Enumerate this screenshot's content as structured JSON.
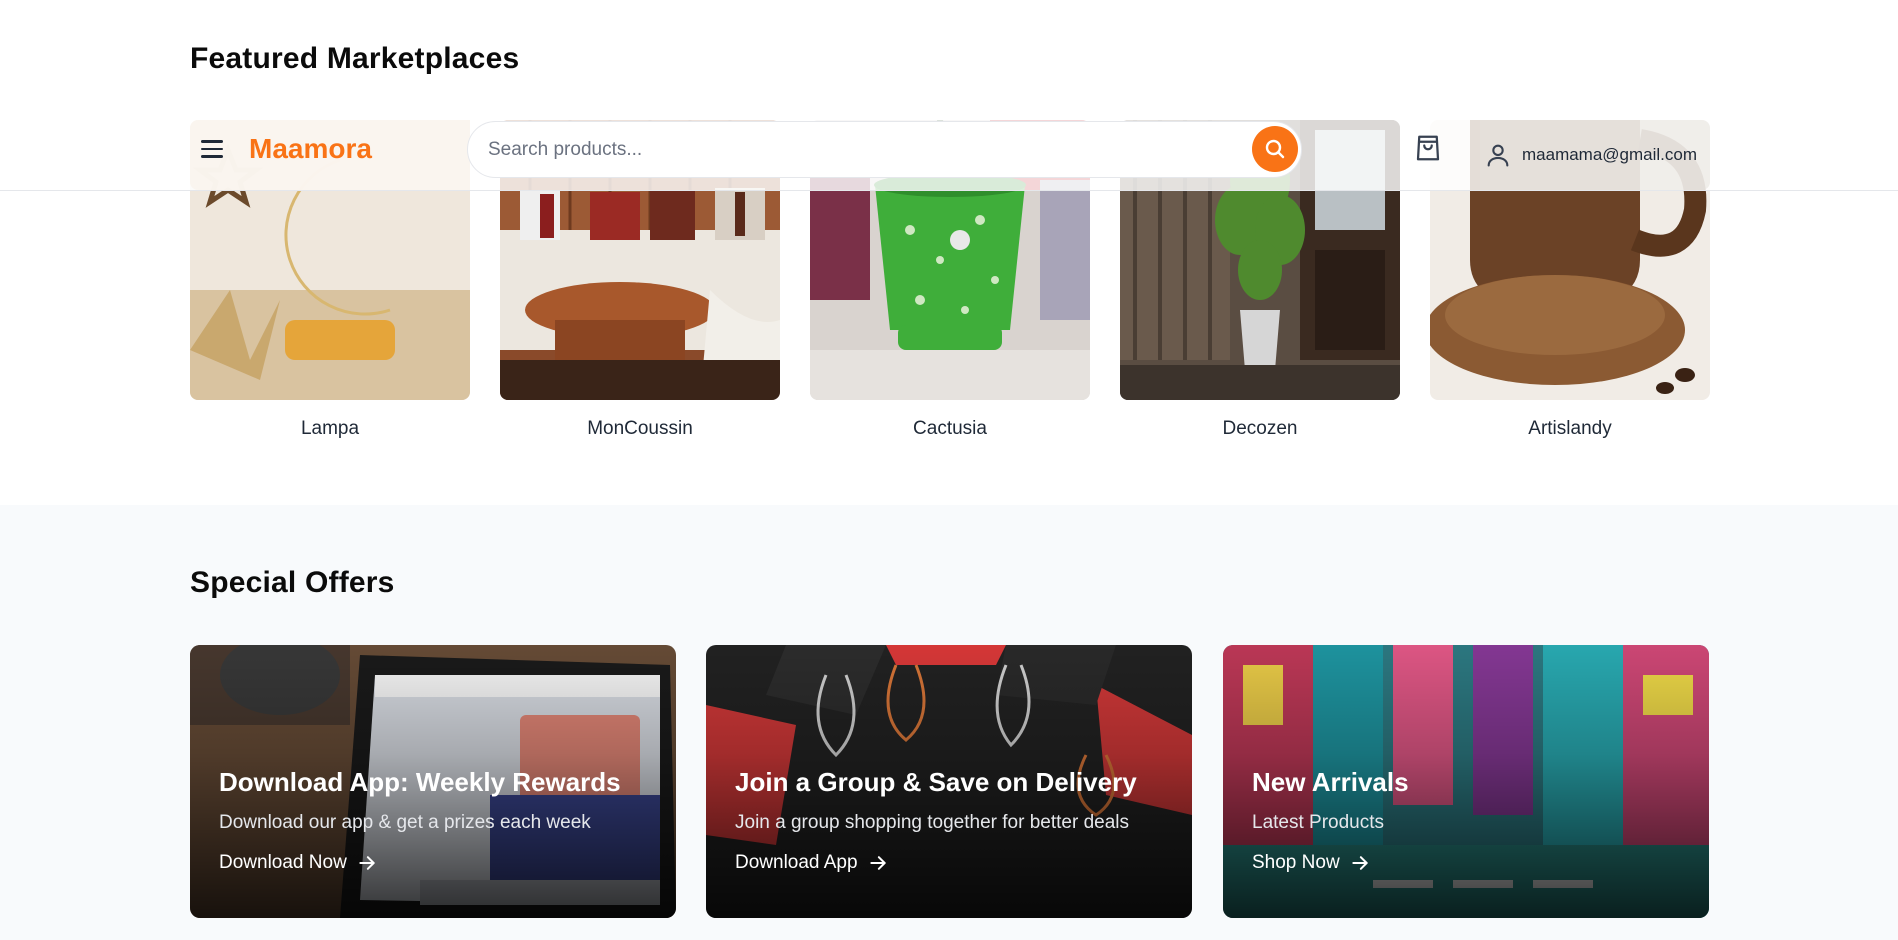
{
  "featured": {
    "title": "Featured Marketplaces",
    "items": [
      {
        "label": "Lampa",
        "image": "ramadan-crescent-lamp"
      },
      {
        "label": "MonCoussin",
        "image": "sofa-with-cushions"
      },
      {
        "label": "Cactusia",
        "image": "potted-aloe-plant"
      },
      {
        "label": "Decozen",
        "image": "indoor-bamboo-plant"
      },
      {
        "label": "Artislandy",
        "image": "wooden-mug-on-coaster"
      }
    ]
  },
  "header": {
    "brand": "Maamora",
    "search_placeholder": "Search products...",
    "user_email": "maamama@gmail.com",
    "icons": [
      "menu-icon",
      "search-icon",
      "shopping-bag-icon",
      "user-icon"
    ],
    "accent_color": "#f97316"
  },
  "offers": {
    "title": "Special Offers",
    "cards": [
      {
        "title": "Download App: Weekly Rewards",
        "subtitle": "Download our app & get a prizes each week",
        "cta": "Download Now",
        "image": "laptop-shopify"
      },
      {
        "title": "Join a Group & Save on Delivery",
        "subtitle": "Join a group shopping together for better deals",
        "cta": "Download App",
        "image": "shopping-bags"
      },
      {
        "title": "New Arrivals",
        "subtitle": "Latest Products",
        "cta": "Shop Now",
        "image": "city-street"
      }
    ]
  }
}
